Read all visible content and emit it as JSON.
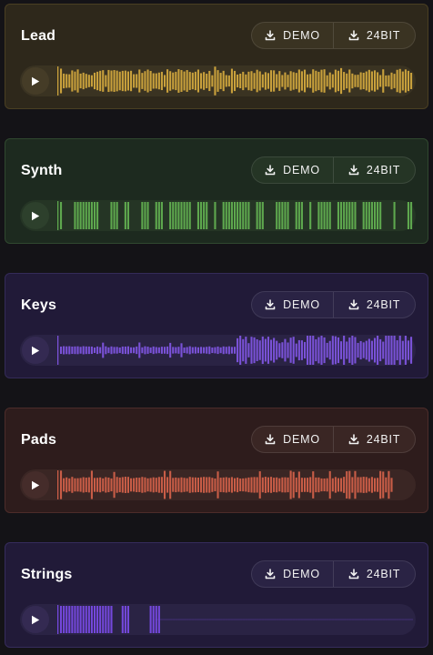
{
  "buttons": {
    "demo_label": "DEMO",
    "hires_label": "24BIT"
  },
  "tracks": [
    {
      "title": "Lead",
      "card_bg": "#2e281b",
      "card_border": "#4a3f22",
      "player_bg": "#3a3322",
      "play_bg": "#453c27",
      "wave_color": "#c9a13c",
      "seed": 11,
      "pattern": "full"
    },
    {
      "title": "Synth",
      "card_bg": "#1d2a1f",
      "card_border": "#30482f",
      "player_bg": "#253525",
      "play_bg": "#2d402c",
      "wave_color": "#5ea84e",
      "seed": 23,
      "pattern": "blocks"
    },
    {
      "title": "Keys",
      "card_bg": "#211a38",
      "card_border": "#342b58",
      "player_bg": "#2a2344",
      "play_bg": "#342a52",
      "wave_color": "#7a52d8",
      "seed": 37,
      "pattern": "rise"
    },
    {
      "title": "Pads",
      "card_bg": "#2e1c1c",
      "card_border": "#4c2c2a",
      "player_bg": "#3a2624",
      "play_bg": "#452c2a",
      "wave_color": "#c95d47",
      "seed": 41,
      "pattern": "steady"
    },
    {
      "title": "Strings",
      "card_bg": "#211a38",
      "card_border": "#362c5c",
      "player_bg": "#2a2344",
      "play_bg": "#342a52",
      "wave_color": "#7448dc",
      "seed": 53,
      "pattern": "short"
    }
  ]
}
